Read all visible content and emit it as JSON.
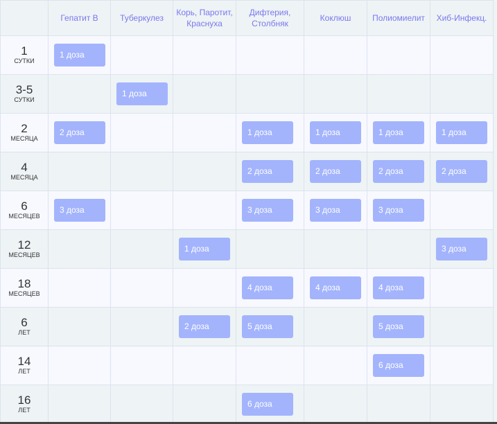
{
  "columns": [
    "",
    "Гепатит В",
    "Туберкулез",
    "Корь, Паротит, Краснуха",
    "Дифтерия, Столбняк",
    "Коклюш",
    "Полиомиелит",
    "Хиб-Инфекц."
  ],
  "rows": [
    {
      "num": "1",
      "unit": "сутки",
      "cells": [
        "1 доза",
        "",
        "",
        "",
        "",
        "",
        ""
      ]
    },
    {
      "num": "3-5",
      "unit": "сутки",
      "cells": [
        "",
        "1 доза",
        "",
        "",
        "",
        "",
        ""
      ]
    },
    {
      "num": "2",
      "unit": "месяца",
      "cells": [
        "2 доза",
        "",
        "",
        "1 доза",
        "1 доза",
        "1 доза",
        "1 доза"
      ]
    },
    {
      "num": "4",
      "unit": "месяца",
      "cells": [
        "",
        "",
        "",
        "2 доза",
        "2 доза",
        "2 доза",
        "2 доза"
      ]
    },
    {
      "num": "6",
      "unit": "месяцев",
      "cells": [
        "3 доза",
        "",
        "",
        "3 доза",
        "3 доза",
        "3 доза",
        ""
      ]
    },
    {
      "num": "12",
      "unit": "месяцев",
      "cells": [
        "",
        "",
        "1 доза",
        "",
        "",
        "",
        "3 доза"
      ]
    },
    {
      "num": "18",
      "unit": "месяцев",
      "cells": [
        "",
        "",
        "",
        "4 доза",
        "4 доза",
        "4 доза",
        ""
      ]
    },
    {
      "num": "6",
      "unit": "лет",
      "cells": [
        "",
        "",
        "2 доза",
        "5 доза",
        "",
        "5 доза",
        ""
      ]
    },
    {
      "num": "14",
      "unit": "лет",
      "cells": [
        "",
        "",
        "",
        "",
        "",
        "6 доза",
        ""
      ]
    },
    {
      "num": "16",
      "unit": "лет",
      "cells": [
        "",
        "",
        "",
        "6 доза",
        "",
        "",
        ""
      ]
    }
  ]
}
